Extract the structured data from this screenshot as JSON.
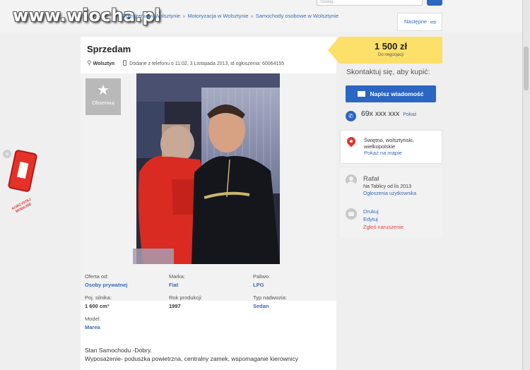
{
  "watermark": "www.wiocha.pl",
  "breadcrumb": {
    "items": [
      "Ogłoszenia w Wolsztynie",
      "Motoryzacja w Wolsztynie",
      "Samochody osobowe w Wolsztynie"
    ],
    "separator": "»"
  },
  "search": {
    "placeholder": "Szukaj..."
  },
  "next_label": "Następne",
  "ad": {
    "title": "Sprzedam",
    "city": "Wolsztyn",
    "added_text": "Dodane z telefonu o 11:02, 3 Listopada 2013, id ogłoszenia: 60064155",
    "observe_label": "Obserwuj"
  },
  "params": [
    {
      "label": "Oferta od:",
      "value": "Osoby prywatnej",
      "link": true
    },
    {
      "label": "Marka:",
      "value": "Fiat",
      "link": true
    },
    {
      "label": "Paliwo:",
      "value": "LPG",
      "link": true
    },
    {
      "label": "Poj. silnika:",
      "value": "1 600 cm³",
      "link": false
    },
    {
      "label": "Rok produkcji:",
      "value": "1997",
      "link": false
    },
    {
      "label": "Typ nadwozia:",
      "value": "Sedan",
      "link": true
    },
    {
      "label": "Model:",
      "value": "Marea",
      "link": true
    }
  ],
  "description": {
    "line1": "Stan Samochodu -Dobry.",
    "line2": "Wyposażenie- poduszka powietrzna, centralny zamek, wspomaganie kierownicy"
  },
  "price": {
    "amount": "1 500 zł",
    "note": "Do negocjacji"
  },
  "contact": {
    "title": "Skontaktuj się, aby kupić:",
    "message_button": "Napisz wiadomość",
    "phone": "69x xxx xxx",
    "show_phone": "Pokaż"
  },
  "location": {
    "line1": "Świętno, wolsztyński,",
    "line2": "wielkopolskie",
    "map_link": "Pokaż na mapie"
  },
  "seller": {
    "name": "Rafał",
    "since": "Na Tablicy od lis 2013",
    "ads_link": "Ogłoszenia użytkownika",
    "links": [
      "Drukuj",
      "Edytuj",
      "Zgłoś naruszenie"
    ]
  },
  "promo": {
    "text": "KORZYSTAJ MOBILNIE"
  },
  "colors": {
    "link": "#3a6ab4",
    "primary_button": "#2b66c2",
    "price_tag": "#fde06a",
    "map_pin": "#e2332d",
    "report_link": "#dd4444"
  }
}
